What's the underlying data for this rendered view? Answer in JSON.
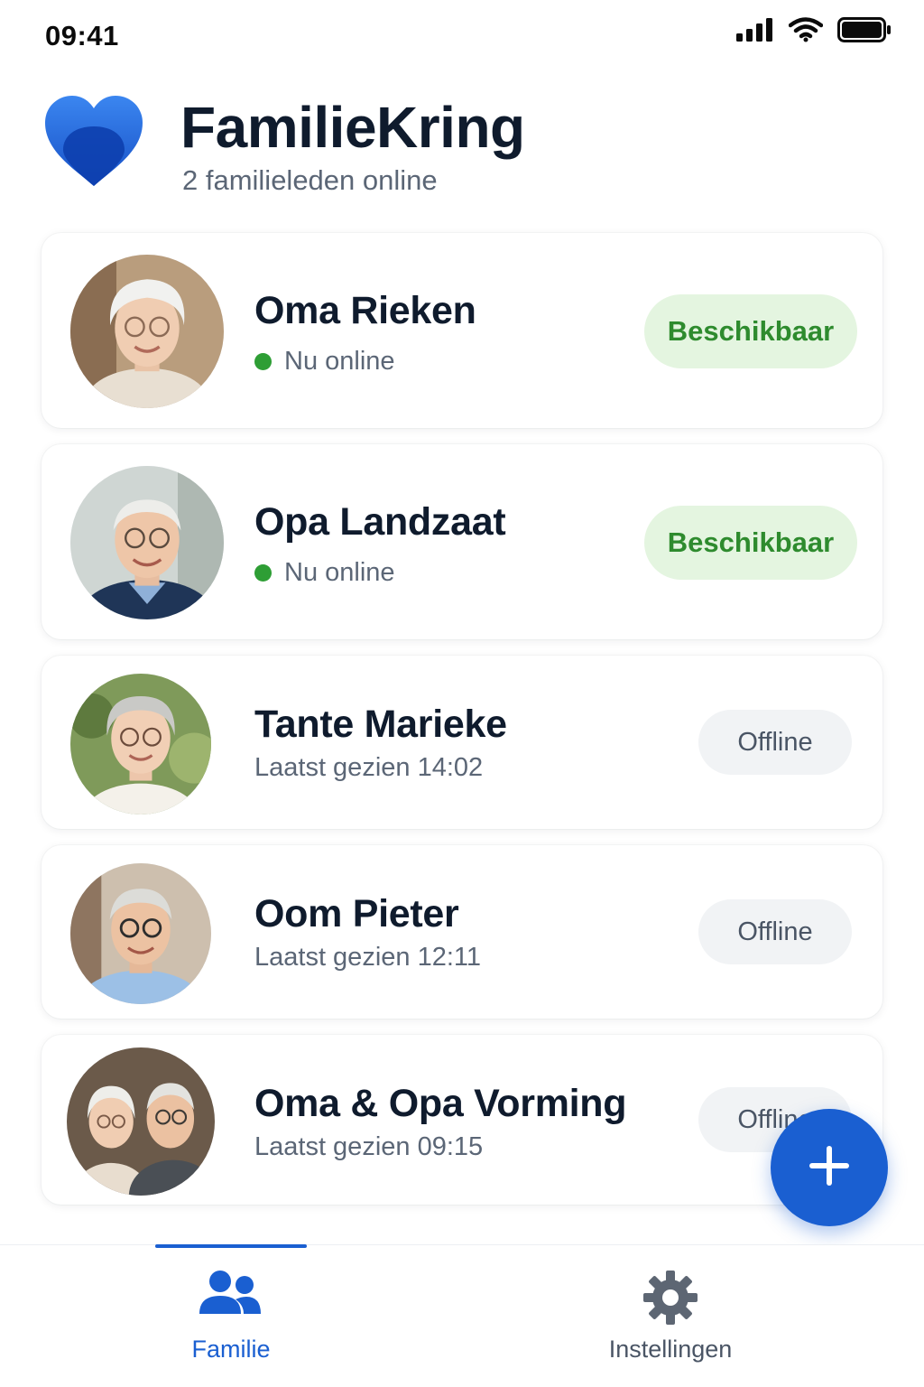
{
  "status_bar": {
    "time": "09:41"
  },
  "header": {
    "title": "FamilieKring",
    "subtitle": "2 familieleden online"
  },
  "members": [
    {
      "name": "Oma Rieken",
      "status": "Nu online",
      "online": true,
      "badge": "Beschikbaar"
    },
    {
      "name": "Opa Landzaat",
      "status": "Nu online",
      "online": true,
      "badge": "Beschikbaar"
    },
    {
      "name": "Tante Marieke",
      "status": "Laatst gezien 14:02",
      "online": false,
      "badge": "Offline"
    },
    {
      "name": "Oom Pieter",
      "status": "Laatst gezien 12:11",
      "online": false,
      "badge": "Offline"
    },
    {
      "name": "Oma & Opa Vorming",
      "status": "Laatst gezien 09:15",
      "online": false,
      "badge": "Offline"
    }
  ],
  "fab": {
    "icon": "plus-icon"
  },
  "bottom_nav": {
    "items": [
      {
        "label": "Familie",
        "icon": "people-icon",
        "active": true
      },
      {
        "label": "Instellingen",
        "icon": "gear-icon",
        "active": false
      }
    ]
  },
  "colors": {
    "primary": "#1a5fd1",
    "available_bg": "#e4f5e0",
    "available_text": "#2e8b2e",
    "online_dot": "#2e9e35",
    "offline_bg": "#f1f3f5"
  }
}
